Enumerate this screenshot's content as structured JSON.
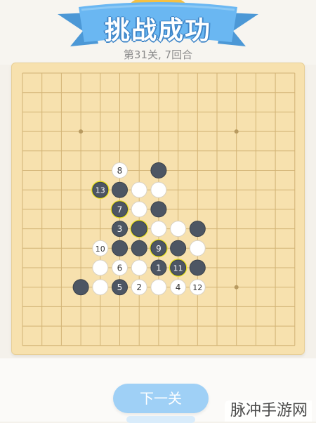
{
  "header": {
    "title": "挑战成功",
    "subtitle": "第31关, 7回合",
    "ribbon_color": "#6ab7f2",
    "trophy_color": "#f5c043"
  },
  "board": {
    "size": 15,
    "background_color": "#f7e1ae",
    "line_color": "#d2b375",
    "star_points": [
      [
        3,
        3
      ],
      [
        11,
        3
      ],
      [
        11,
        11
      ]
    ],
    "highlight_color": "#e7e023",
    "stones": [
      {
        "col": 5,
        "row": 5,
        "color": "white",
        "label": "8"
      },
      {
        "col": 7,
        "row": 5,
        "color": "black",
        "label": ""
      },
      {
        "col": 4,
        "row": 6,
        "color": "black",
        "label": "13",
        "highlight": true
      },
      {
        "col": 5,
        "row": 6,
        "color": "black",
        "label": ""
      },
      {
        "col": 6,
        "row": 6,
        "color": "white",
        "label": ""
      },
      {
        "col": 7,
        "row": 6,
        "color": "white",
        "label": ""
      },
      {
        "col": 5,
        "row": 7,
        "color": "black",
        "label": "7",
        "highlight": true
      },
      {
        "col": 6,
        "row": 7,
        "color": "white",
        "label": ""
      },
      {
        "col": 7,
        "row": 7,
        "color": "black",
        "label": ""
      },
      {
        "col": 5,
        "row": 8,
        "color": "black",
        "label": "3"
      },
      {
        "col": 6,
        "row": 8,
        "color": "black",
        "label": "",
        "highlight": true
      },
      {
        "col": 7,
        "row": 8,
        "color": "white",
        "label": ""
      },
      {
        "col": 8,
        "row": 8,
        "color": "white",
        "label": ""
      },
      {
        "col": 9,
        "row": 8,
        "color": "black",
        "label": ""
      },
      {
        "col": 4,
        "row": 9,
        "color": "white",
        "label": "10"
      },
      {
        "col": 5,
        "row": 9,
        "color": "black",
        "label": ""
      },
      {
        "col": 6,
        "row": 9,
        "color": "black",
        "label": ""
      },
      {
        "col": 7,
        "row": 9,
        "color": "black",
        "label": "9",
        "highlight": true
      },
      {
        "col": 8,
        "row": 9,
        "color": "black",
        "label": ""
      },
      {
        "col": 9,
        "row": 9,
        "color": "white",
        "label": ""
      },
      {
        "col": 4,
        "row": 10,
        "color": "white",
        "label": ""
      },
      {
        "col": 5,
        "row": 10,
        "color": "white",
        "label": "6"
      },
      {
        "col": 6,
        "row": 10,
        "color": "white",
        "label": ""
      },
      {
        "col": 7,
        "row": 10,
        "color": "black",
        "label": "1"
      },
      {
        "col": 8,
        "row": 10,
        "color": "black",
        "label": "11",
        "highlight": true
      },
      {
        "col": 9,
        "row": 10,
        "color": "black",
        "label": ""
      },
      {
        "col": 3,
        "row": 11,
        "color": "black",
        "label": ""
      },
      {
        "col": 4,
        "row": 11,
        "color": "white",
        "label": ""
      },
      {
        "col": 5,
        "row": 11,
        "color": "black",
        "label": "5"
      },
      {
        "col": 6,
        "row": 11,
        "color": "white",
        "label": "2"
      },
      {
        "col": 7,
        "row": 11,
        "color": "white",
        "label": ""
      },
      {
        "col": 8,
        "row": 11,
        "color": "white",
        "label": "4"
      },
      {
        "col": 9,
        "row": 11,
        "color": "white",
        "label": "12"
      }
    ]
  },
  "footer": {
    "next_button_label": "下一关",
    "button_color": "#9fd0f6"
  },
  "watermark": {
    "text": "脉冲手游网"
  }
}
